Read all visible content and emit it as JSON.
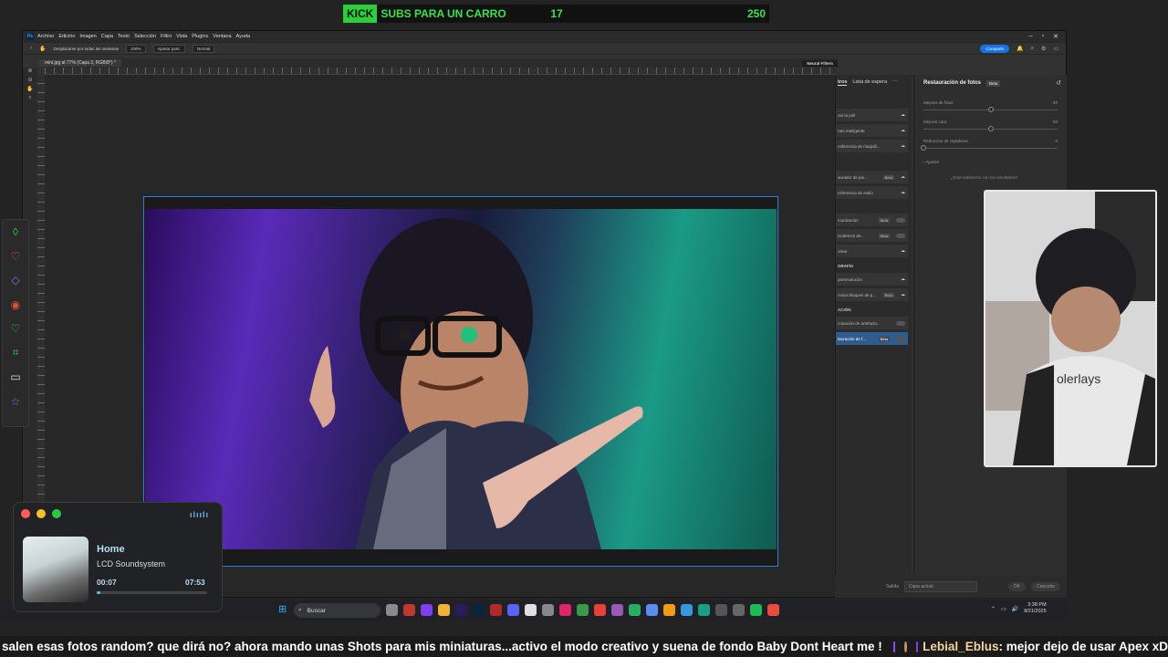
{
  "goal_bar": {
    "platform": "KICK",
    "label": "SUBS PARA UN CARRO",
    "current": "17",
    "target": "250"
  },
  "photoshop": {
    "menu": [
      "Archivo",
      "Edición",
      "Imagen",
      "Capa",
      "Texto",
      "Selección",
      "Filtro",
      "Vista",
      "Plugins",
      "Ventana",
      "Ayuda"
    ],
    "options": {
      "scroll_all": "Desplazarse por todas las ventanas",
      "zoom": "100%",
      "fit": "Ajustar pant.",
      "mode": "Normal",
      "share": "Compartir"
    },
    "doc_tab": "mini.jpg al 77% (Capa 3, RGB/8*) *",
    "neural_filters_label": "Neural Filters",
    "panel_tabs": {
      "active": "Todos los filtros",
      "active_visible": "tros",
      "waitlist": "Lista de espera"
    },
    "filters": [
      {
        "label": "Suavizar la piel"
      },
      {
        "label": "Retrato inteligente"
      },
      {
        "label": "Transferencia de maquillaje"
      },
      {
        "label": "Restaurador de paisajes",
        "beta": "Beta"
      },
      {
        "label": "Transferencia de estilo"
      },
      {
        "label": "Armonización",
        "beta": "Beta"
      },
      {
        "label": "Coincidencia de color",
        "beta": "Beta"
      },
      {
        "label": "Colorear"
      },
      {
        "label": "Superresolución"
      },
      {
        "label": "Eliminar bloques de JPEG",
        "beta": "Beta"
      },
      {
        "label": "Eliminación de artefactos"
      },
      {
        "label": "Restauración de fotos",
        "beta": "Beta"
      }
    ],
    "filter_labels_visible": [
      "zar la piel",
      "rato inteligente",
      "nsferencia de maquill...",
      "aurador de pai...",
      "nsferencia de estilo",
      "monización",
      "ncidencia de...",
      "orear",
      "perresolución",
      "minar bloques de p...",
      "minación de artefacto...",
      "tauración de f..."
    ],
    "sections": [
      "FOTOGRAFÍA",
      "RESTAURACIÓN"
    ],
    "sections_visible": [
      "GRAFÍA",
      "ACIÓN"
    ],
    "restore_panel": {
      "title": "Restauración de fotos",
      "beta": "Beta",
      "sliders": [
        {
          "label": "Mejorar de fotos",
          "value": "50",
          "fraction": 0.5
        },
        {
          "label": "Mejorar cara",
          "value": "50",
          "fraction": 0.5
        },
        {
          "label": "Reducción de rayaduras",
          "value": "0",
          "fraction": 0.0
        }
      ],
      "adjust": "Ajustes",
      "feedback": "¿Está satisfecho con los resultados?"
    },
    "output_label": "Salida",
    "output_value": "Capa actual",
    "ok": "OK",
    "cancel": "Cancelar"
  },
  "taskbar": {
    "search": "Buscar",
    "time": "3:38 PM",
    "date": "8/21/2025"
  },
  "music": {
    "title": "Home",
    "artist": "LCD Soundsystem",
    "elapsed": "00:07",
    "total": "07:53",
    "progress": 0.015
  },
  "ticker": {
    "message": "salen esas fotos random? que dirá no? ahora mando unas Shots para mis miniaturas...activo el modo creativo y suena de fondo Baby Dont Heart me !",
    "user": "Lebial_Eblus",
    "user_message": ": mejor dejo de usar Apex xD"
  },
  "colors": {
    "kick_green": "#2ad03a",
    "accent_blue": "#1473e6",
    "music_accent": "#6ab8e6",
    "username": "#f2d59a"
  }
}
